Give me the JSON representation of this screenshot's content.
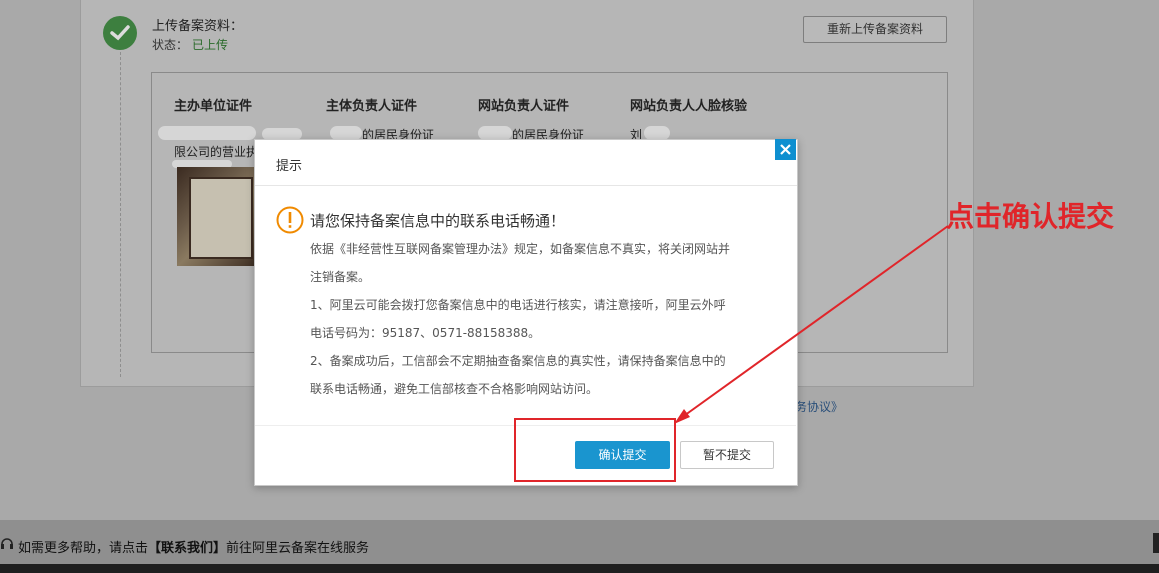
{
  "background": {
    "upload": {
      "title": "上传备案资料：",
      "status_label": "状态：",
      "status_value": "已上传",
      "reupload_button": "重新上传备案资料"
    },
    "doc_columns": [
      "主办单位证件",
      "主体负责人证件",
      "网站负责人证件",
      "网站负责人人脸核验"
    ],
    "partial_texts": {
      "col1_line2": "限公司的营业执",
      "col2_line1": "的居民身份证",
      "col3_line1": "的居民身份证",
      "col4_line1": "刘"
    },
    "agreement_link": "务协议》"
  },
  "dialog": {
    "title": "提示",
    "warning_title": "请您保持备案信息中的联系电话畅通！",
    "body_lines": [
      "依据《非经营性互联网备案管理办法》规定，如备案信息不真实，将关闭网站并",
      "注销备案。",
      "1、阿里云可能会拨打您备案信息中的电话进行核实，请注意接听，阿里云外呼",
      "电话号码为：95187、0571-88158388。",
      "2、备案成功后，工信部会不定期抽查备案信息的真实性，请保持备案信息中的",
      "联系电话畅通，避免工信部核查不合格影响网站访问。"
    ],
    "confirm_button": "确认提交",
    "later_button": "暂不提交"
  },
  "help_bar": {
    "text_before": "如需更多帮助，请点击",
    "link": "【联系我们】",
    "text_after": "前往阿里云备案在线服务"
  },
  "annotation": {
    "text": "点击确认提交",
    "color": "#e0252a"
  },
  "colors": {
    "accent": "#1a95cf",
    "success": "#3d7f3f"
  }
}
